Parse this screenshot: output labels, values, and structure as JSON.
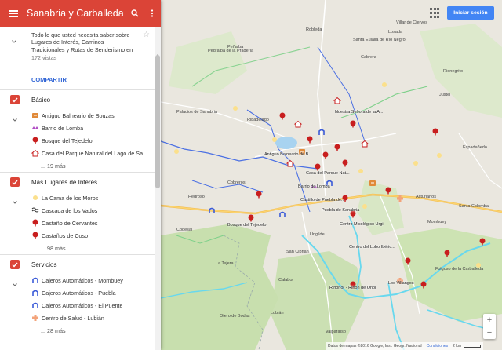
{
  "header": {
    "title": "Sanabria y Carballeda",
    "menu_icon": "menu-icon",
    "search_icon": "search-icon",
    "more_icon": "more-vert-icon",
    "color": "#db4437"
  },
  "description": {
    "text": "Todo lo que usted necesita saber sobre Lugares de Interés, Caminos Tradicionales y Rutas de Senderismo en",
    "views": "172 vistas",
    "share": "COMPARTIR"
  },
  "layers": [
    {
      "title": "Básico",
      "items": [
        {
          "icon": "spa-icon",
          "label": "Antiguo Balneario de Bouzas"
        },
        {
          "icon": "village-icon",
          "label": "Barrio de Lomba"
        },
        {
          "icon": "tree-icon",
          "label": "Bosque del Tejedelo"
        },
        {
          "icon": "house-icon",
          "label": "Casa del Parque Natural del Lago de Sa..."
        }
      ],
      "more": "... 19 más"
    },
    {
      "title": "Más Lugares de Interés",
      "items": [
        {
          "icon": "sun-icon",
          "label": "La Cama de los Moros"
        },
        {
          "icon": "waterfall-icon",
          "label": "Cascada de los Vados"
        },
        {
          "icon": "tree-icon",
          "label": "Castaño de Cervantes"
        },
        {
          "icon": "tree-icon",
          "label": "Castaños de Coso"
        }
      ],
      "more": "... 98 más"
    },
    {
      "title": "Servicios",
      "items": [
        {
          "icon": "atm-icon",
          "label": "Cajeros Automáticos - Mombuey"
        },
        {
          "icon": "atm-icon",
          "label": "Cajeros Automáticos - Puebla"
        },
        {
          "icon": "atm-icon",
          "label": "Cajeros Automáticos - El Puente"
        },
        {
          "icon": "medical-cross-icon",
          "label": "Centro de Salud - Lubián"
        }
      ],
      "more": "... 28 más"
    }
  ],
  "map": {
    "signin": "Iniciar sesión",
    "attribution": "Datos de mapas ©2016 Google, Inst. Geogr. Nacional",
    "terms": "Condiciones",
    "scale": "2 km",
    "places": [
      {
        "name": "Pedralba de la Pradería"
      },
      {
        "name": "Robleda"
      },
      {
        "name": "Santa Eulalia de Río Negro"
      },
      {
        "name": "Nuestra Señora de la A..."
      },
      {
        "name": "Antiguo Balneario de B..."
      },
      {
        "name": "Casa del Parque Nat..."
      },
      {
        "name": "Barrio de Lomba"
      },
      {
        "name": "Castillo de Puebla de..."
      },
      {
        "name": "Bosque del Tejedelo"
      },
      {
        "name": "Centro Micológico Urgi"
      },
      {
        "name": "Centro del Lobo Ibéric..."
      },
      {
        "name": "Rihonor - Rihon de Onor"
      },
      {
        "name": "Los Villangos"
      },
      {
        "name": "Mombuey"
      },
      {
        "name": "Folgoso de la Carballeda"
      },
      {
        "name": "Espadañedo"
      },
      {
        "name": "Hedroso"
      },
      {
        "name": "Calabor"
      },
      {
        "name": "Ribadelago"
      },
      {
        "name": "Cobreros"
      },
      {
        "name": "Puebla de Sanabria"
      },
      {
        "name": "Lubián"
      },
      {
        "name": "La Tejera"
      },
      {
        "name": "Asturianos"
      },
      {
        "name": "Santa Colomba"
      },
      {
        "name": "San Ciprián"
      },
      {
        "name": "Ungilde"
      },
      {
        "name": "Villar de Ciervos"
      },
      {
        "name": "Rionegrito"
      },
      {
        "name": "Codesal"
      },
      {
        "name": "Valparaíso"
      },
      {
        "name": "Otero de Bodas"
      },
      {
        "name": "Cabrera"
      },
      {
        "name": "Losada"
      },
      {
        "name": "Peñalba"
      },
      {
        "name": "Justel"
      },
      {
        "name": "Palacios de Sanabria"
      }
    ]
  }
}
